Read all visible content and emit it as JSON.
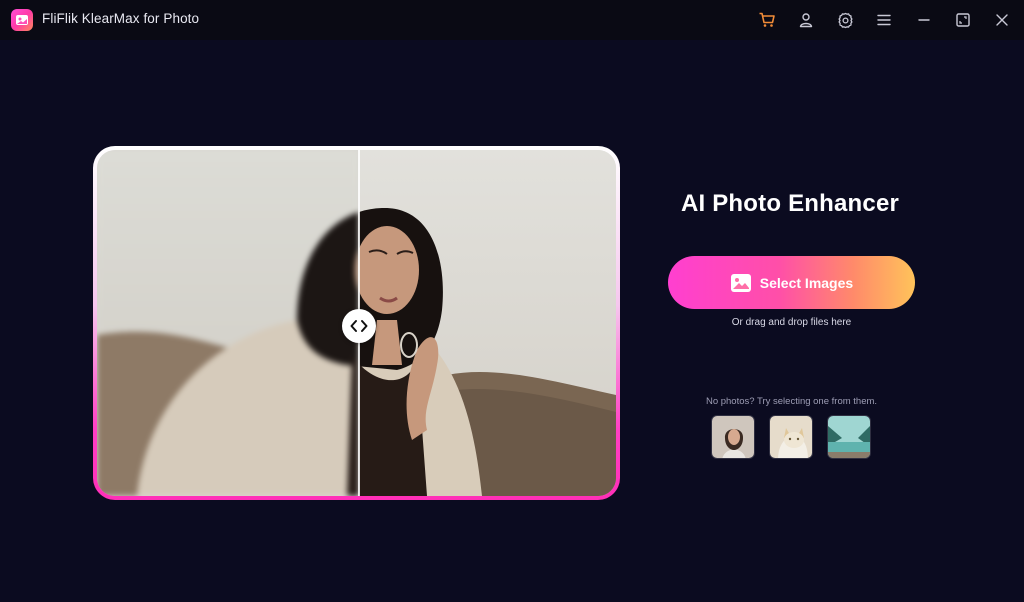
{
  "app": {
    "title": "FliFlik KlearMax for Photo"
  },
  "titlebar": {
    "icons": [
      "cart-icon",
      "user-icon",
      "gear-icon",
      "menu-icon",
      "minimize-icon",
      "maximize-icon",
      "close-icon"
    ],
    "accent_color": "#f28c38"
  },
  "compare": {
    "handle_icon": "left-right-arrows-icon"
  },
  "panel": {
    "headline": "AI Photo Enhancer",
    "select_button": "Select Images",
    "select_icon": "image-icon",
    "drag_hint": "Or drag and drop files here",
    "samples_hint": "No photos? Try selecting one from them.",
    "samples": [
      "portrait-sample",
      "cat-sample",
      "landscape-sample"
    ]
  },
  "colors": {
    "background": "#0b0b20",
    "button_gradient_start": "#ff3fd0",
    "button_gradient_end": "#ffc35a"
  }
}
